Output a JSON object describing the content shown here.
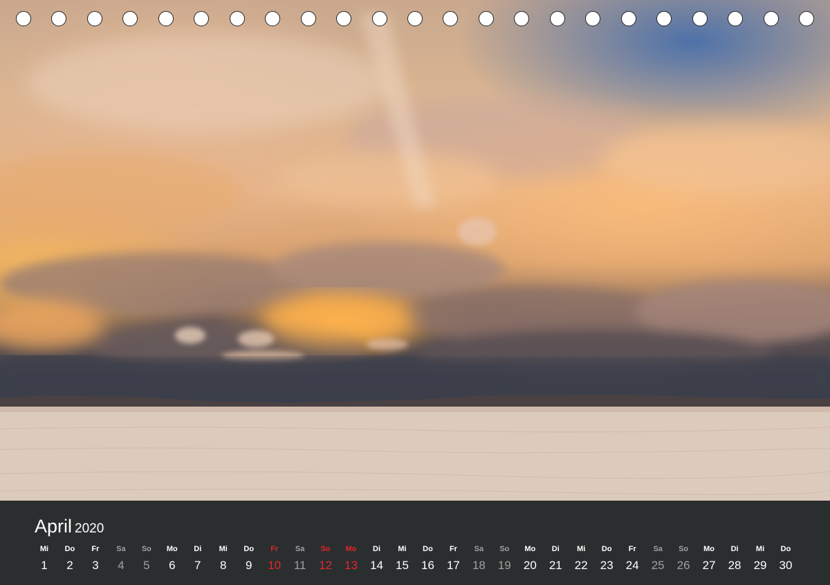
{
  "calendar": {
    "month": "April",
    "year": "2020",
    "days": [
      {
        "name": "Mi",
        "date": "1",
        "type": "weekday"
      },
      {
        "name": "Do",
        "date": "2",
        "type": "weekday"
      },
      {
        "name": "Fr",
        "date": "3",
        "type": "weekday"
      },
      {
        "name": "Sa",
        "date": "4",
        "type": "weekend"
      },
      {
        "name": "So",
        "date": "5",
        "type": "weekend"
      },
      {
        "name": "Mo",
        "date": "6",
        "type": "weekday"
      },
      {
        "name": "Di",
        "date": "7",
        "type": "weekday"
      },
      {
        "name": "Mi",
        "date": "8",
        "type": "weekday"
      },
      {
        "name": "Do",
        "date": "9",
        "type": "weekday"
      },
      {
        "name": "Fr",
        "date": "10",
        "type": "holiday"
      },
      {
        "name": "Sa",
        "date": "11",
        "type": "weekend"
      },
      {
        "name": "So",
        "date": "12",
        "type": "holiday"
      },
      {
        "name": "Mo",
        "date": "13",
        "type": "holiday"
      },
      {
        "name": "Di",
        "date": "14",
        "type": "weekday"
      },
      {
        "name": "Mi",
        "date": "15",
        "type": "weekday"
      },
      {
        "name": "Do",
        "date": "16",
        "type": "weekday"
      },
      {
        "name": "Fr",
        "date": "17",
        "type": "weekday"
      },
      {
        "name": "Sa",
        "date": "18",
        "type": "weekend"
      },
      {
        "name": "So",
        "date": "19",
        "type": "weekend"
      },
      {
        "name": "Mo",
        "date": "20",
        "type": "weekday"
      },
      {
        "name": "Di",
        "date": "21",
        "type": "weekday"
      },
      {
        "name": "Mi",
        "date": "22",
        "type": "weekday"
      },
      {
        "name": "Do",
        "date": "23",
        "type": "weekday"
      },
      {
        "name": "Fr",
        "date": "24",
        "type": "weekday"
      },
      {
        "name": "Sa",
        "date": "25",
        "type": "weekend"
      },
      {
        "name": "So",
        "date": "26",
        "type": "weekend"
      },
      {
        "name": "Mo",
        "date": "27",
        "type": "weekday"
      },
      {
        "name": "Di",
        "date": "28",
        "type": "weekday"
      },
      {
        "name": "Mi",
        "date": "29",
        "type": "weekday"
      },
      {
        "name": "Do",
        "date": "30",
        "type": "weekday"
      }
    ]
  },
  "colors": {
    "bar_background": "#2b2e2f",
    "weekday_text": "#ffffff",
    "weekend_text": "#a0a0a0",
    "holiday_text": "#e3262c"
  },
  "photo": {
    "subject": "storm clouds at sunset over salt flat"
  },
  "binding_holes": 23
}
